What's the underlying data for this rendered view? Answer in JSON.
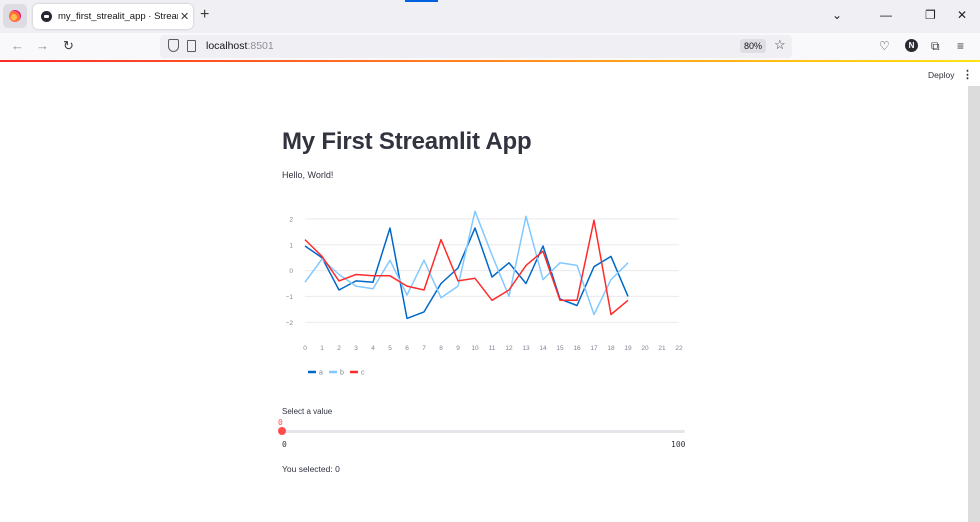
{
  "browser": {
    "tab_title": "my_first_strealit_app · Streamlit",
    "url_host": "localhost",
    "url_port": ":8501",
    "zoom": "80%",
    "profile_initial": "N"
  },
  "app": {
    "deploy_label": "Deploy",
    "title": "My First Streamlit App",
    "greeting": "Hello, World!",
    "slider": {
      "label": "Select a value",
      "value": 0,
      "min": 0,
      "max": 100,
      "value_text": "0",
      "min_text": "0",
      "max_text": "100"
    },
    "selected_text": "You selected: 0"
  },
  "colors": {
    "accent": "#ff4b4b",
    "series_a": "#0068c9",
    "series_b": "#83c9ff",
    "series_c": "#ff2b2b"
  },
  "chart_data": {
    "type": "line",
    "x": [
      0,
      1,
      2,
      3,
      4,
      5,
      6,
      7,
      8,
      9,
      10,
      11,
      12,
      13,
      14,
      15,
      16,
      17,
      18,
      19
    ],
    "xlim": [
      0,
      22
    ],
    "xticks": [
      0,
      1,
      2,
      3,
      4,
      5,
      6,
      7,
      8,
      9,
      10,
      11,
      12,
      13,
      14,
      15,
      16,
      17,
      18,
      19,
      20,
      21,
      22
    ],
    "ylim": [
      -2.3,
      2.5
    ],
    "yticks": [
      -2,
      -1,
      0,
      1,
      2
    ],
    "grid": true,
    "legend_position": "bottom-left",
    "series": [
      {
        "name": "a",
        "color": "#0068c9",
        "values": [
          0.95,
          0.5,
          -0.75,
          -0.4,
          -0.45,
          1.65,
          -1.85,
          -1.6,
          -0.5,
          0.1,
          1.65,
          -0.25,
          0.3,
          -0.5,
          0.95,
          -1.1,
          -1.35,
          0.15,
          0.55,
          -1.0
        ]
      },
      {
        "name": "b",
        "color": "#83c9ff",
        "values": [
          -0.45,
          0.45,
          -0.15,
          -0.6,
          -0.7,
          0.4,
          -0.95,
          0.4,
          -1.05,
          -0.6,
          2.3,
          0.6,
          -1.0,
          2.1,
          -0.35,
          0.3,
          0.2,
          -1.7,
          -0.35,
          0.3
        ]
      },
      {
        "name": "c",
        "color": "#ff2b2b",
        "values": [
          1.2,
          0.55,
          -0.4,
          -0.15,
          -0.2,
          -0.2,
          -0.6,
          -0.75,
          1.2,
          -0.4,
          -0.3,
          -1.15,
          -0.75,
          0.2,
          0.75,
          -1.15,
          -1.15,
          1.95,
          -1.7,
          -1.15
        ]
      }
    ]
  }
}
